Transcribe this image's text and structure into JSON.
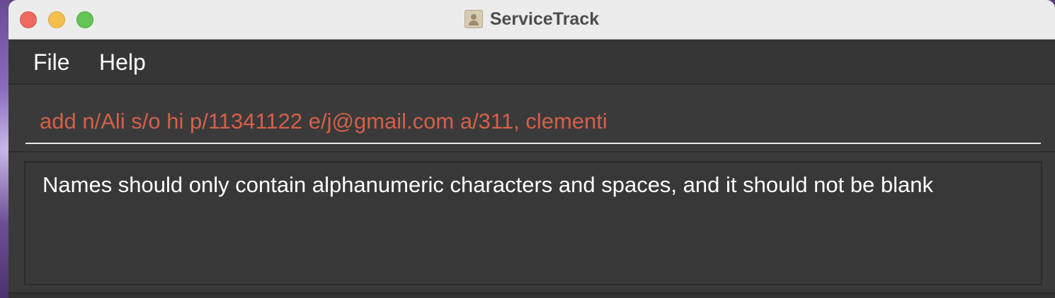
{
  "window": {
    "title": "ServiceTrack",
    "app_icon": "contact-card-icon"
  },
  "menu": {
    "items": [
      {
        "label": "File"
      },
      {
        "label": "Help"
      }
    ]
  },
  "command_box": {
    "value": "add n/Ali s/o hi p/11341122 e/j@gmail.com a/311, clementi",
    "text_color": "#d4604a"
  },
  "result_display": {
    "message": "Names should only contain alphanumeric characters and spaces, and it should not be blank"
  }
}
